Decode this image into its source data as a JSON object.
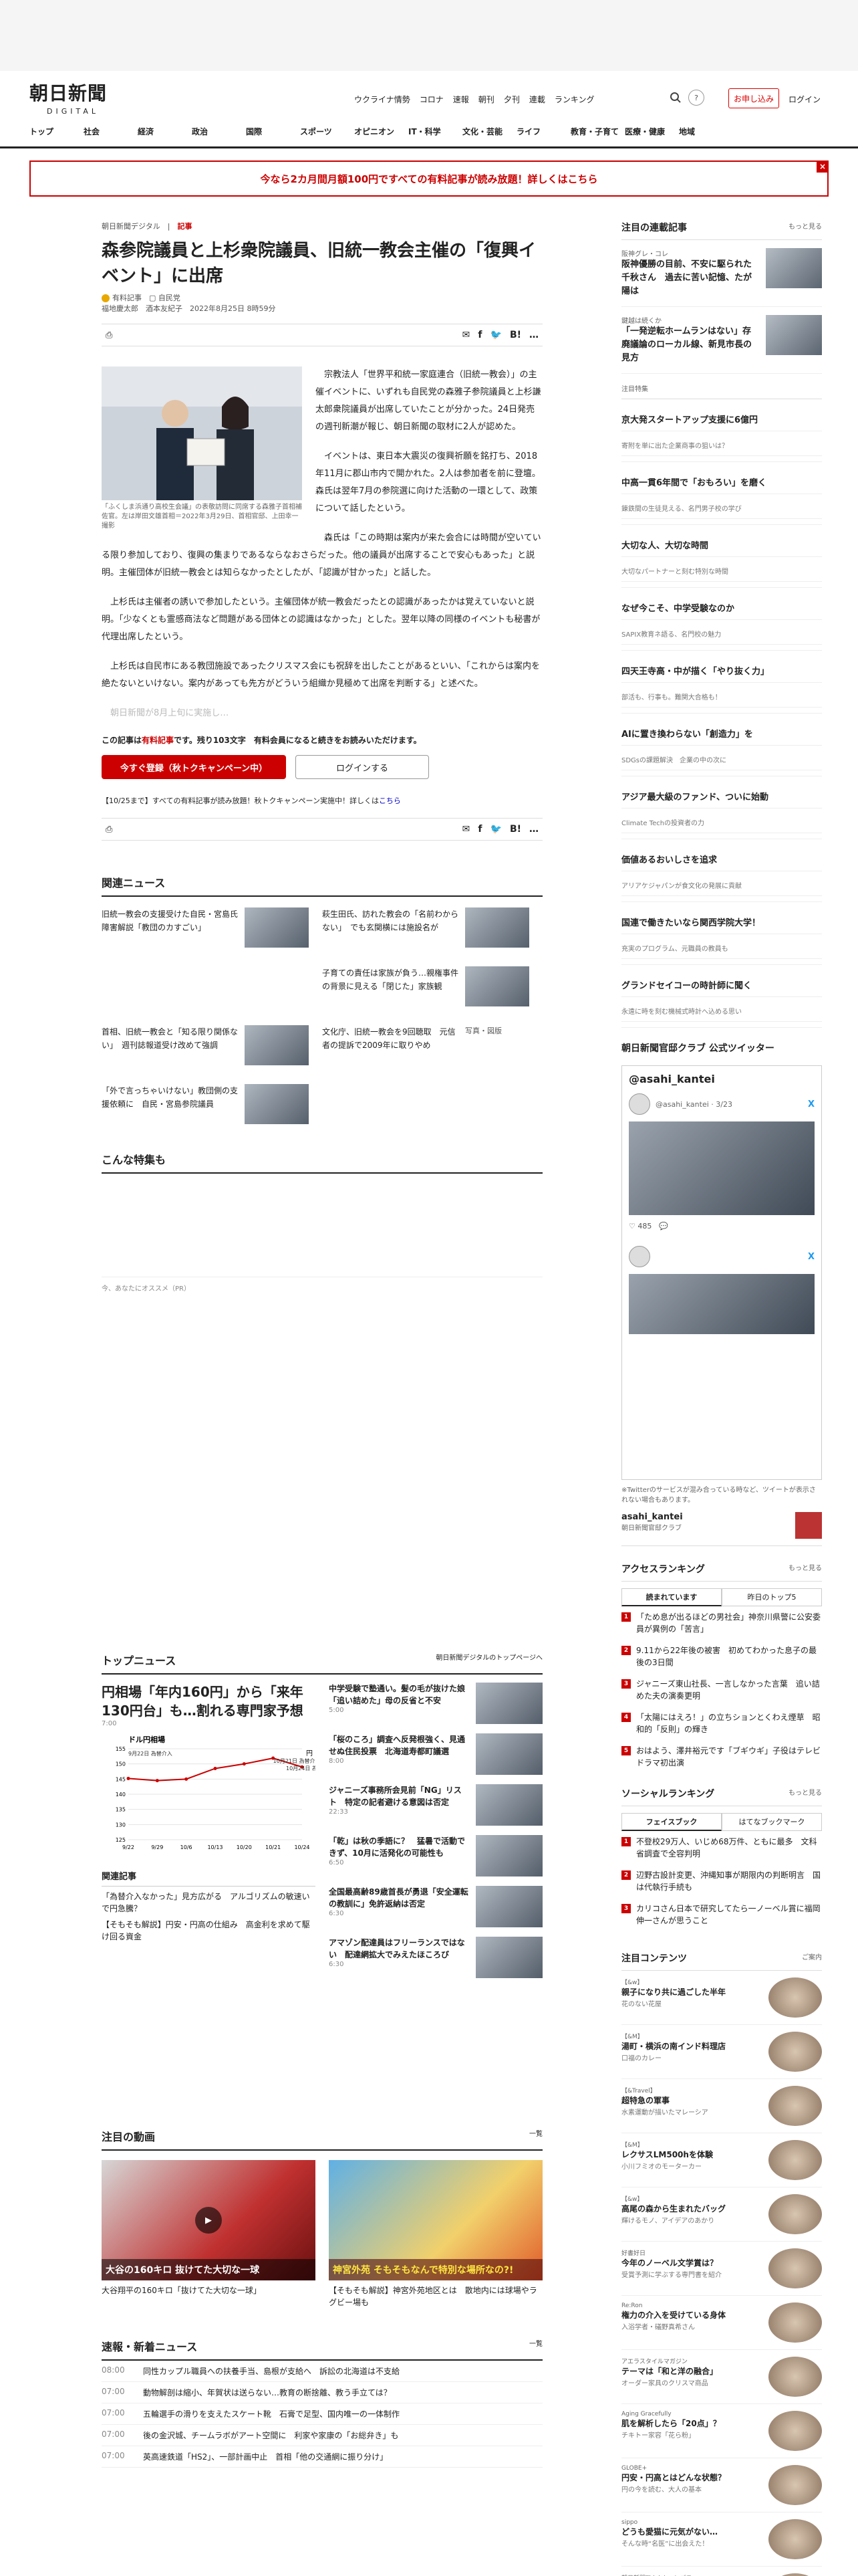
{
  "header": {
    "logo_main": "朝日新聞",
    "logo_sub": "DIGITAL",
    "nav": [
      "ウクライナ情勢",
      "コロナ",
      "速報",
      "朝刊",
      "夕刊",
      "連載",
      "ランキング"
    ],
    "subscribe": "お申し込み",
    "login": "ログイン"
  },
  "categories": [
    "トップ",
    "社会",
    "経済",
    "政治",
    "国際",
    "スポーツ",
    "オピニオン",
    "IT・科学",
    "文化・芸能",
    "ライフ",
    "教育・子育て",
    "医療・健康",
    "地域"
  ],
  "banner": {
    "text": "今なら2カ月間月額100円ですべての有料記事が読み放題！詳しくはこちら",
    "close": "×"
  },
  "article": {
    "crumb": "朝日新聞デジタル",
    "crumb_tag": "記事",
    "title": "森参院議員と上杉衆院議員、旧統一教会主催の「復興イベント」に出席",
    "paid_label": "有料記事",
    "party_label": "自民党",
    "authors": "福地慶太郎　酒本友紀子",
    "date": "2022年8月25日 8時59分",
    "photo_caption": "「ふくしま浜通り高校生会議」の表敬訪問に同席する森雅子首相補佐官。左は岸田文雄首相＝2022年3月29日、首相官邸、上田幸一撮影",
    "p1": "宗教法人「世界平和統一家庭連合（旧統一教会）」の主催イベントに、いずれも自民党の森雅子参院議員と上杉謙太郎衆院議員が出席していたことが分かった。24日発売の週刊新潮が報じ、朝日新聞の取材に2人が認めた。",
    "p2": "イベントは、東日本大震災の復興祈願を銘打ち、2018年11月に郡山市内で開かれた。2人は参加者を前に登壇。森氏は翌年7月の参院選に向けた活動の一環として、政策について話したという。",
    "p3": "森氏は「この時期は案内が来た会合には時間が空いている限り参加しており、復興の集まりであるならなおさらだった。他の議員が出席することで安心もあった」と説明。主催団体が旧統一教会とは知らなかったとしたが、「認識が甘かった」と話した。",
    "p4": "上杉氏は主催者の誘いで参加したという。主催団体が統一教会だったとの認識があったかは覚えていないと説明。「少なくとも霊感商法など問題がある団体との認識はなかった」とした。翌年以降の同様のイベントも秘書が代理出席したという。",
    "p5": "上杉氏は自民市にある教団施設であったクリスマス会にも祝辞を出したことがあるといい、「これからは案内を絶たないといけない。案内があっても先方がどういう組織か見極めて出席を判断する」と述べた。",
    "p6": "朝日新聞が8月上旬に実施し…",
    "lock_text1": "この記事は",
    "lock_paid": "有料記事",
    "lock_text2": "です。残り103文字　有料会員になると続きをお読みいただけます。",
    "btn_register": "今すぐ登録（秋トクキャンペーン中）",
    "btn_login": "ログインする",
    "notice": "【10/25まで】すべての有料記事が読み放題！秋トクキャンペーン実施中！詳しくは",
    "notice_link": "こちら"
  },
  "related": {
    "heading": "関連ニュース",
    "items": [
      "旧統一教会の支援受けた自民・宮島氏　障害解説「教団のカすごい」",
      "萩生田氏、訪れた教会の「名前わからない」　でも玄関横には施設名が",
      "子育ての責任は家族が負う…親権事件の背景に見える「閉じた」家族観",
      "首相、旧統一教会と「知る限り関係ない」　週刊誌報道受け改めて強調",
      "文化庁、旧統一教会を9回聴取　元信者の提訴で2009年に取りやめ",
      "「外で言っちゃいけない」教団側の支援依頼に　自民・宮島参院議員"
    ],
    "photo_alt": "写真・図版"
  },
  "special": {
    "heading": "こんな特集も",
    "pr": "今、あなたにオススメ（PR）"
  },
  "topnews": {
    "heading": "トップニュース",
    "more": "朝日新聞デジタルのトップページへ",
    "lead_title": "円相場「年内160円」から「来年130円台」も…割れる専門家予想",
    "lead_time": "7:00",
    "related_h": "関連記事",
    "related": [
      "「為替介入なかった」見方広がる　アルゴリズムの敏速いで円急騰？",
      "【そもそも解説】円安・円高の仕組み　高金利を求めて駆け回る資金"
    ],
    "items": [
      {
        "t": "中学受験で塾通い。髪の毛が抜けた娘　「追い詰めた」母の反省と不安",
        "m": "5:00"
      },
      {
        "t": "「桜のころ」調査へ反発根強く、見通せぬ住民投票　北海道寿都町議選",
        "m": "8:00"
      },
      {
        "t": "ジャニーズ事務所会見前「NG」リスト　特定の記者避ける意図は否定",
        "m": "22:33"
      },
      {
        "t": "「乾」は秋の季語に？　猛暑で活動できず、10月に活発化の可能性も",
        "m": "6:50"
      },
      {
        "t": "全国最高齢89歳首長が勇退「安全運転の教訓に」免許返納は否定",
        "m": "6:30"
      },
      {
        "t": "アマゾン配達員はフリーランスではない　配達網拡大でみえたほころび",
        "m": "6:30"
      }
    ]
  },
  "chart_data": {
    "type": "line",
    "title": "ドル円相場",
    "ylabel": "円",
    "categories": [
      "9/22",
      "9/29",
      "10/6",
      "10/13",
      "10/20",
      "10/21",
      "10/24"
    ],
    "values": [
      145.2,
      144.5,
      145.0,
      148.5,
      150.0,
      151.9,
      149.0
    ],
    "ylim": [
      125,
      155
    ],
    "annotations": [
      "9月22日 為替介入",
      "10月21日 為替介入",
      "10月24日 為替介入"
    ]
  },
  "video": {
    "heading": "注目の動画",
    "more": "一覧",
    "items": [
      "大谷翔平の160キロ「抜けてた大切な一球」",
      "【そもそも解説】神宮外苑地区とは　散地内には球場やラグビー場も"
    ],
    "overlay1": "大谷の160キロ 抜けてた大切な一球",
    "overlay2": "神宮外苑 そもそもなんで特別な場所なの?!"
  },
  "breaking": {
    "heading": "速報・新着ニュース",
    "more": "一覧",
    "items": [
      {
        "time": "08:00",
        "text": "同性カップル職員への扶養手当、島根が支給へ　訴訟の北海道は不支給"
      },
      {
        "time": "07:00",
        "text": "動物解剖は縮小、年賀状は送らない…教育の断捨離、教う手立ては？"
      },
      {
        "time": "07:00",
        "text": "五輪選手の滑りを支えたスケート靴　石膏で足型、国内唯一の一体制作"
      },
      {
        "time": "07:00",
        "text": "後の金沢城、チームラボがアート空間に　利家や家康の「お総弁き」も"
      },
      {
        "time": "07:00",
        "text": "英高速鉄道「HS2」、一部計画中止　首相「他の交通網に振り分け」"
      }
    ]
  },
  "side": {
    "series_h": "注目の連載記事",
    "more": "もっと見る",
    "series": [
      {
        "c": "阪神グレ・コレ",
        "t": "阪神優勝の目前、不安に駆られた千秋さん　過去に苦い記憶、たが陽は"
      },
      {
        "c": "鍵越は続くか",
        "t": "「一発逆転ホームランはない」存廃議論のローカル線、新見市長の見方"
      }
    ],
    "list_h": "注目特集",
    "list": [
      {
        "t": "京大発スタートアップ支援に6億円",
        "s": "寄附を単に出た企業商事の狙いは？"
      },
      {
        "t": "中高一貫6年間で「おもろい」を磨く",
        "s": "錬鉄間の生徒見える、名門男子校の学び"
      },
      {
        "t": "大切な人、大切な時間",
        "s": "大切なパートナーと刻む特別な時間"
      },
      {
        "t": "なぜ今こそ、中学受験なのか",
        "s": "SAPIX教育ネ語る、名門校の魅力"
      },
      {
        "t": "四天王寺高・中が描く「やり抜く力」",
        "s": "部活も、行事も。難関大合格も！"
      },
      {
        "t": "AIに置き換わらない「創造力」を",
        "s": "SDGsの課題解決　企業の中の次に"
      },
      {
        "t": "アジア最大級のファンド、ついに始動",
        "s": "Climate Techの投資者の力"
      },
      {
        "t": "価値あるおいしさを追求",
        "s": "アリアケジャパンが食文化の発展に貢献"
      },
      {
        "t": "国連で働きたいなら関西学院大学！",
        "s": "充実のプログラム、元職員の教員も"
      },
      {
        "t": "グランドセイコーの時計師に聞く",
        "s": "永遠に時を刻む機械式時計へ込める思い"
      }
    ],
    "tw_h": "朝日新聞官邸クラブ 公式ツイッター",
    "tw_account": "@asahi_kantei",
    "tw_handle": "@asahi_kantei · 3/23",
    "tw_stats": "♡ 485　💬",
    "tw_note": "※Twitterのサービスが混み合っている時など、ツイートが表示されない場合もあります。",
    "tw_footer": "asahi_kantei",
    "tw_footer_sub": "朝日新聞官邸クラブ",
    "rank_h": "アクセスランキング",
    "rank_tabs": [
      "読まれています",
      "昨日のトップ5"
    ],
    "ranks": [
      "「ため息が出るほどの男社会」神奈川県警に公安委員が異例の「苦言」",
      "9.11から22年後の被害　初めてわかった息子の最後の3日間",
      "ジャニーズ東山社長、一言しなかった言葉　追い詰めた夫の演奏更明",
      "「太陽にはえろ！」の立ちションとくわえ煙草　昭和的「反則」の輝き",
      "おはよう、澤井裕元です「ブギウギ」子役はテレビドラマ初出演"
    ],
    "social_h": "ソーシャルランキング",
    "social_tabs": [
      "フェイスブック",
      "はてなブックマーク"
    ],
    "social": [
      "不登校29万人、いじめ68万件、ともに最多　文科省調査で全容判明",
      "辺野古設計変更、沖縄知事が期限内の判断明言　国は代執行手続も",
      "カリコさん日本で研究してたら一ノーベル賞に福岡伸一さんが思うこと"
    ],
    "contents_h": "注目コンテンツ",
    "contents_more": "ご案内",
    "contents": [
      {
        "tag": "【&w】",
        "t": "親子になり共に過ごした半年",
        "s": "花のない花屋"
      },
      {
        "tag": "【&M】",
        "t": "湯町・横浜の南インド料理店",
        "s": "口福のカレー"
      },
      {
        "tag": "【&Travel】",
        "t": "超特急の軍事",
        "s": "水素運動が描いたマレーシア"
      },
      {
        "tag": "【&M】",
        "t": "レクサスLM500hを体験",
        "s": "小川フミオのモーターカー"
      },
      {
        "tag": "【&w】",
        "t": "高尾の森から生まれたバッグ",
        "s": "輝けるモノ、アイデアのあかり"
      },
      {
        "tag": "好書好日",
        "t": "今年のノーベル文学賞は？",
        "s": "受賞予測に学ぶする専門書を紹介"
      },
      {
        "tag": "Re:Ron",
        "t": "権力の介入を受けている身体",
        "s": "入浴学者・礒野真希さん"
      },
      {
        "tag": "アエラスタイルマガジン",
        "t": "テーマは「和と洋の融合」",
        "s": "オーダー家具のクリスマ商品"
      },
      {
        "tag": "Aging Gracefully",
        "t": "肌を解析したら「20点」？",
        "s": "チキトー家容「花ら粉」"
      },
      {
        "tag": "GLOBE+",
        "t": "円安・円高とはどんな状態？",
        "s": "円の今を読む、大人の基本"
      },
      {
        "tag": "sippo",
        "t": "どうも愛猫に元気がない…",
        "s": "そんな時“名医”に出会えた！"
      },
      {
        "tag": "朝日新聞Thinkキャンパス",
        "t": "東大卒ピアニスト角野さん",
        "s": "大学のうまさ、ともに考える。"
      }
    ]
  }
}
